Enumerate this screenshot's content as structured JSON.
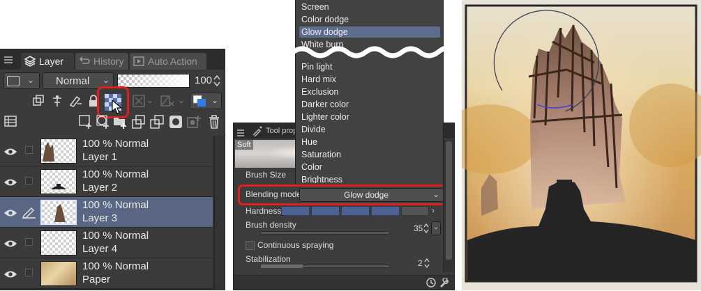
{
  "layer_panel": {
    "tabs": [
      {
        "label": "Layer",
        "icon": "layers-icon"
      },
      {
        "label": "History",
        "icon": "history-icon"
      },
      {
        "label": "Auto Action",
        "icon": "auto-action-icon"
      }
    ],
    "blend_mode": "Normal",
    "opacity": "100",
    "layers": [
      {
        "mode": "100 % Normal",
        "name": "Layer 1",
        "selected": false
      },
      {
        "mode": "100 % Normal",
        "name": "Layer 2",
        "selected": false
      },
      {
        "mode": "100 % Normal",
        "name": "Layer 3",
        "selected": true
      },
      {
        "mode": "100 % Normal",
        "name": "Layer 4",
        "selected": false
      },
      {
        "mode": "100 % Normal",
        "name": "Paper",
        "selected": false
      }
    ],
    "highlight_color": "#e0201c"
  },
  "blend_menu": {
    "items_top": [
      "Screen",
      "Color dodge",
      "Glow dodge",
      "White burn"
    ],
    "items_bottom": [
      "Pin light",
      "Hard mix",
      "Exclusion",
      "Darker color",
      "Lighter color",
      "Divide",
      "Hue",
      "Saturation",
      "Color",
      "Brightness"
    ],
    "highlighted": "Glow dodge",
    "highlight_color": "#5e6c8e"
  },
  "tool_property": {
    "title": "Tool prope",
    "brush_name": "Soft",
    "brush_size_label": "Brush Size",
    "blending_mode_label": "Blending mode",
    "blending_mode_value": "Glow dodge",
    "hardness_label": "Hardness",
    "brush_density_label": "Brush density",
    "brush_density_value": "35",
    "continuous_spraying_label": "Continuous spraying",
    "stabilization_label": "Stabilization",
    "stabilization_value": "2"
  }
}
